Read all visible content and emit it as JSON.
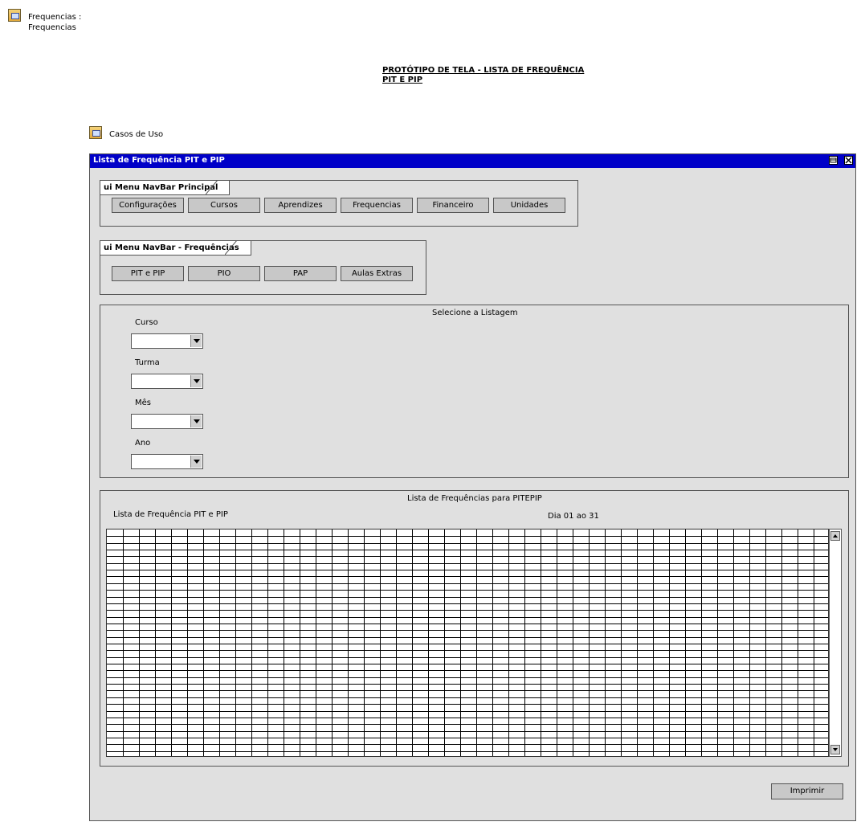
{
  "diagram": {
    "frame_title": "Frequencias :\nFrequencias",
    "heading_line1": "PROTÓTIPO DE TELA - LISTA DE FREQUÊNCIA ",
    "heading_line2": "PIT E PIP",
    "usecase_link": "Casos de Uso"
  },
  "window": {
    "title": "Lista de Frequência PIT e PIP",
    "titlebar_color": "#0000c8",
    "restore_icon": "restore-icon",
    "close_icon": "close-icon"
  },
  "main_nav": {
    "label": "ui Menu NavBar Principal",
    "items": [
      "Configurações",
      "Cursos",
      "Aprendizes",
      "Frequencias",
      "Financeiro",
      "Unidades"
    ]
  },
  "freq_nav": {
    "label": "ui Menu NavBar - Frequências",
    "items": [
      "PIT e PIP",
      "PIO",
      "PAP",
      "Aulas Extras"
    ]
  },
  "filters": {
    "title": "Selecione a Listagem",
    "fields": [
      {
        "label": "Curso",
        "value": ""
      },
      {
        "label": "Turma",
        "value": ""
      },
      {
        "label": "Mês",
        "value": ""
      },
      {
        "label": "Ano",
        "value": ""
      }
    ]
  },
  "list": {
    "title": "Lista de Frequências para PITEPIP",
    "subtitle_left": "Lista de Frequência PIT e PIP",
    "subtitle_right": "Dia 01 ao 31",
    "rows": 34,
    "cols": 45
  },
  "print_button": "Imprimir"
}
